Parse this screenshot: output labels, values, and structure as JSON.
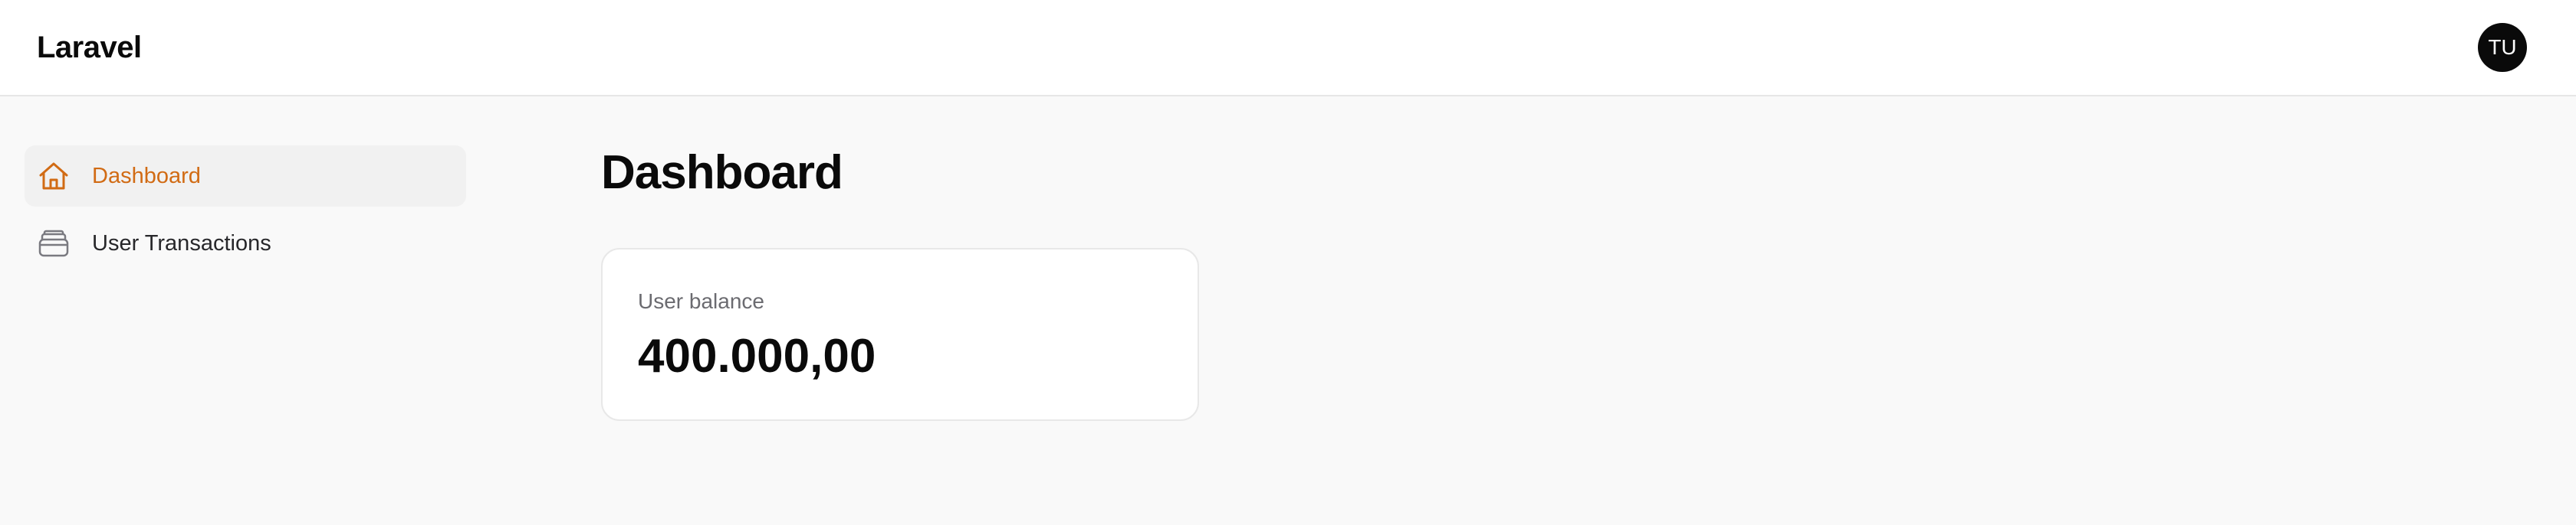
{
  "header": {
    "brand": "Laravel",
    "avatar_initials": "TU"
  },
  "sidebar": {
    "items": [
      {
        "label": "Dashboard",
        "icon": "home-icon",
        "active": true,
        "color": "#d16b14"
      },
      {
        "label": "User Transactions",
        "icon": "wallet-icon",
        "active": false
      }
    ]
  },
  "main": {
    "title": "Dashboard",
    "card": {
      "label": "User balance",
      "value": "400.000,00"
    }
  }
}
